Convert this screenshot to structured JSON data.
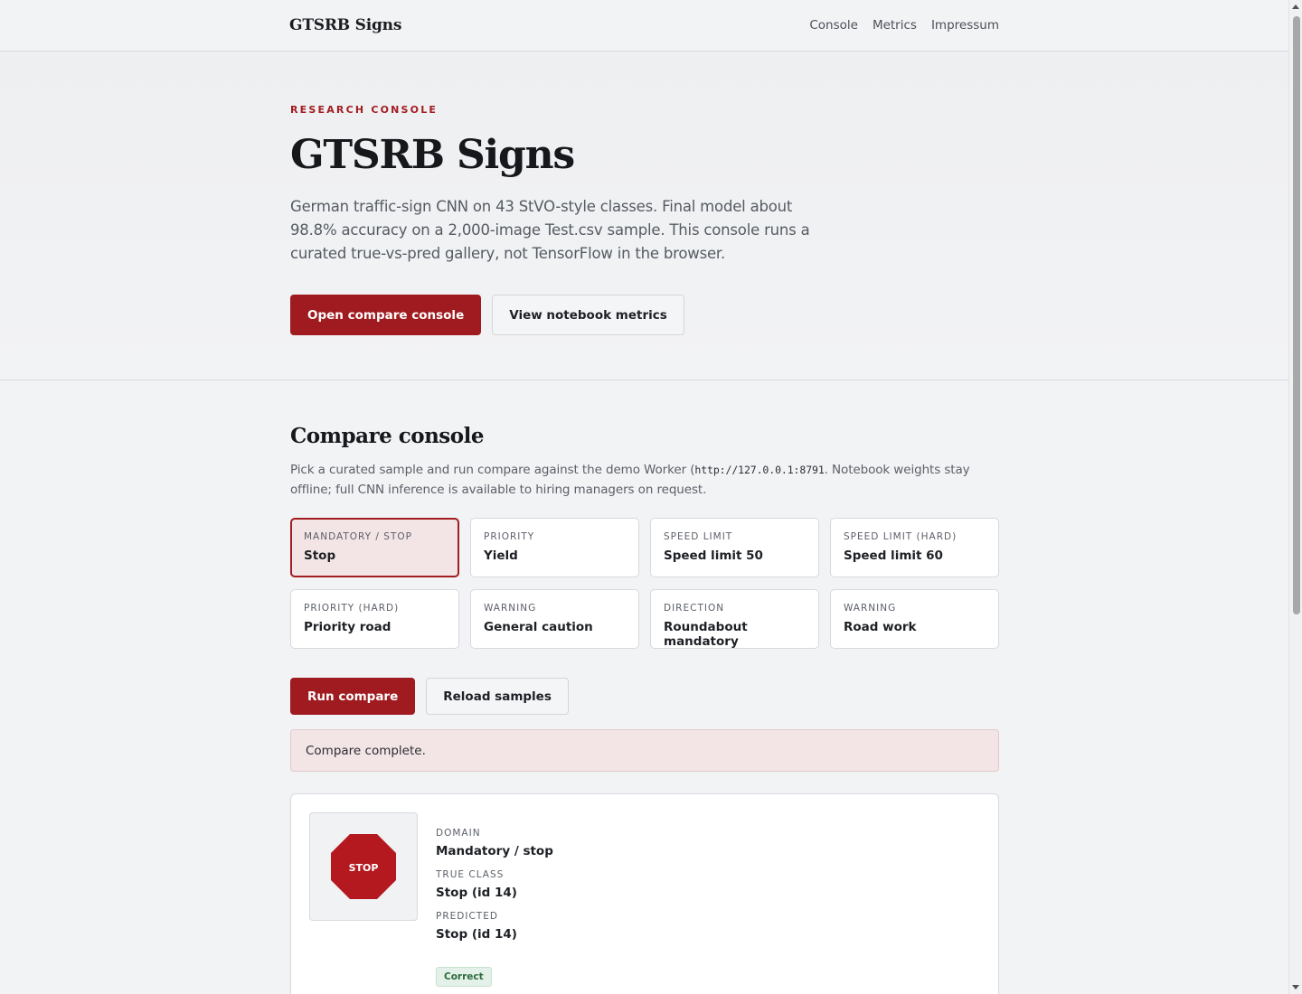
{
  "header": {
    "brand": "GTSRB Signs",
    "nav": [
      "Console",
      "Metrics",
      "Impressum"
    ]
  },
  "hero": {
    "eyebrow": "RESEARCH CONSOLE",
    "title": "GTSRB Signs",
    "description": "German traffic-sign CNN on 43 StVO-style classes. Final model about 98.8% accuracy on a 2,000-image Test.csv sample. This console runs a curated true-vs-pred gallery, not TensorFlow in the browser.",
    "primary_button": "Open compare console",
    "secondary_button": "View notebook metrics"
  },
  "compare": {
    "title": "Compare console",
    "desc_before": "Pick a curated sample and run compare against the demo Worker (",
    "desc_code": "http://127.0.0.1:8791",
    "desc_after": ". Notebook weights stay offline; full CNN inference is available to hiring managers on request.",
    "samples": [
      {
        "category": "MANDATORY / STOP",
        "name": "Stop",
        "selected": true
      },
      {
        "category": "PRIORITY",
        "name": "Yield",
        "selected": false
      },
      {
        "category": "SPEED LIMIT",
        "name": "Speed limit 50",
        "selected": false
      },
      {
        "category": "SPEED LIMIT (HARD)",
        "name": "Speed limit 60",
        "selected": false
      },
      {
        "category": "PRIORITY (HARD)",
        "name": "Priority road",
        "selected": false
      },
      {
        "category": "WARNING",
        "name": "General caution",
        "selected": false
      },
      {
        "category": "DIRECTION",
        "name": "Roundabout mandatory",
        "selected": false
      },
      {
        "category": "WARNING",
        "name": "Road work",
        "selected": false
      }
    ],
    "run_button": "Run compare",
    "reload_button": "Reload samples",
    "status": "Compare complete."
  },
  "result": {
    "sign_text": "STOP",
    "sign_color": "#b3191f",
    "domain_label": "DOMAIN",
    "domain_value": "Mandatory / stop",
    "true_label": "TRUE CLASS",
    "true_value": "Stop (id 14)",
    "pred_label": "PREDICTED",
    "pred_value": "Stop (id 14)",
    "badge": "Correct"
  },
  "colors": {
    "accent": "#9f1b1f",
    "selected_bg": "#f3e5e6",
    "badge_bg": "#e4f1e8"
  }
}
